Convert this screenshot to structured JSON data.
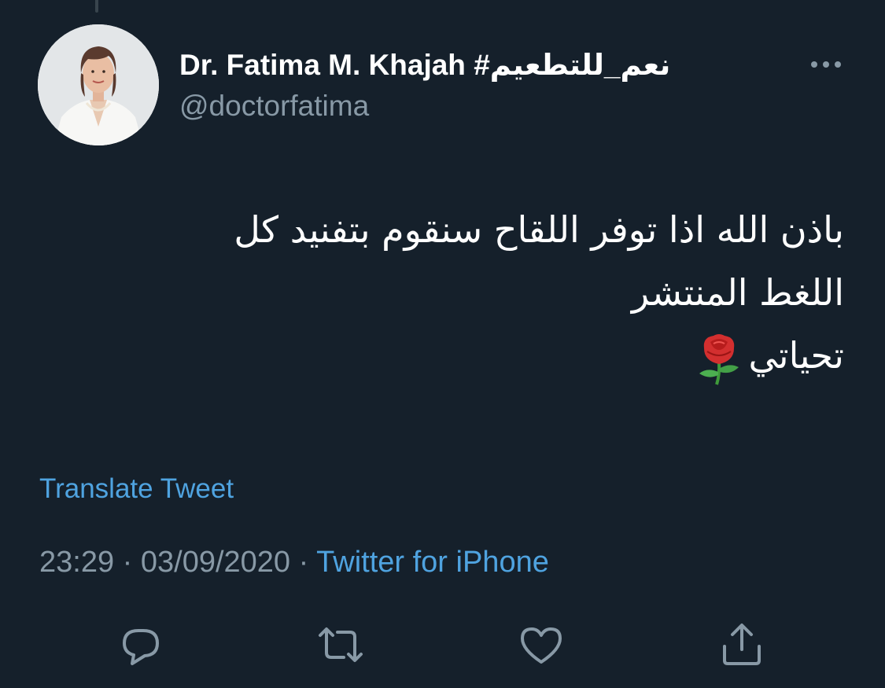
{
  "tweet": {
    "author": {
      "display_name": "Dr. Fatima M. Khajah #نعم_للتطعيم",
      "handle": "@doctorfatima"
    },
    "text_lines": [
      "باذن الله اذا توفر اللقاح سنقوم بتفنيد كل",
      "اللغط المنتشر",
      "تحياتي"
    ],
    "translate_label": "Translate Tweet",
    "time": "23:29",
    "date": "03/09/2020",
    "separator": "·",
    "source": "Twitter for iPhone"
  },
  "icons": {
    "more": "more-horizontal-icon",
    "emoji": "rose-icon",
    "reply": "reply-icon",
    "retweet": "retweet-icon",
    "like": "heart-icon",
    "share": "share-icon"
  },
  "colors": {
    "background": "#15202b",
    "text": "#ffffff",
    "secondary": "#8899a6",
    "link": "#4fa3e0"
  }
}
